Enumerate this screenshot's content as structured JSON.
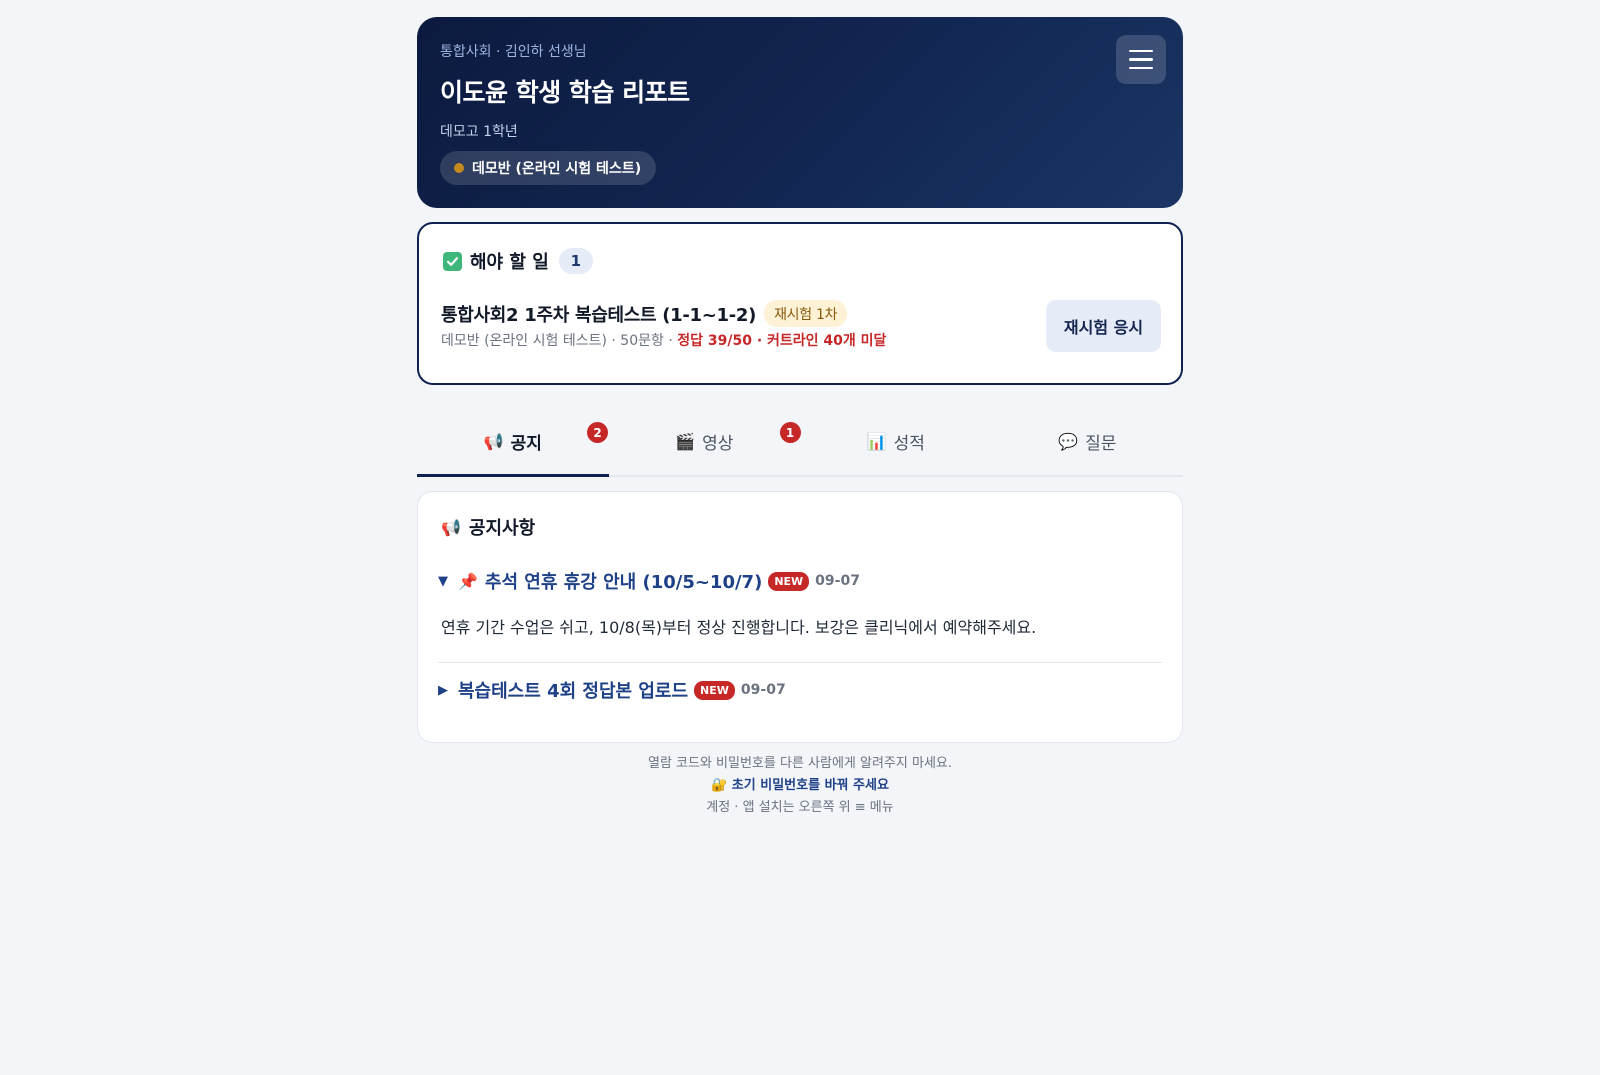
{
  "header": {
    "crumb": "통합사회 · 김인하 선생님",
    "title": "이도윤 학생 학습 리포트",
    "school": "데모고 1학년",
    "class_name": "데모반 (온라인 시험 테스트)"
  },
  "todo": {
    "label": "해야 할 일",
    "count": "1",
    "task": {
      "title": "통합사회2 1주차 복습테스트 (1-1~1-2)",
      "badge": "재시험 1차",
      "meta_prefix": "데모반 (온라인 시험 테스트) · 50문항 · ",
      "meta_warn": "정답 39/50 · 커트라인 40개 미달",
      "action": "재시험 응시"
    }
  },
  "tabs": [
    {
      "icon": "📢",
      "label": "공지",
      "badge": "2",
      "active": true
    },
    {
      "icon": "🎬",
      "label": "영상",
      "badge": "1",
      "active": false
    },
    {
      "icon": "📊",
      "label": "성적",
      "badge": "",
      "active": false
    },
    {
      "icon": "💬",
      "label": "질문",
      "badge": "",
      "active": false
    }
  ],
  "notice": {
    "title": "공지사항",
    "items": [
      {
        "arrow": "▼",
        "pin": "📌",
        "title": "추석 연휴 휴강 안내 (10/5~10/7)",
        "badge": "NEW",
        "date": "09-07",
        "body": "연휴 기간 수업은 쉬고, 10/8(목)부터 정상 진행합니다. 보강은 클리닉에서 예약해주세요."
      },
      {
        "arrow": "▶",
        "title": "복습테스트 4회 정답본 업로드",
        "badge": "NEW",
        "date": "09-07"
      }
    ]
  },
  "footer": {
    "line1": "열람 코드와 비밀번호를 다른 사람에게 알려주지 마세요.",
    "line2": "🔐 초기 비밀번호를 바꿔 주세요",
    "line3": "계정 · 앱 설치는 오른쪽 위 ≡ 메뉴"
  },
  "colors": {
    "header_bg": "#0f2150",
    "accent": "#1e4187",
    "danger": "#c62828",
    "retest_bg": "#fdf1d6"
  }
}
